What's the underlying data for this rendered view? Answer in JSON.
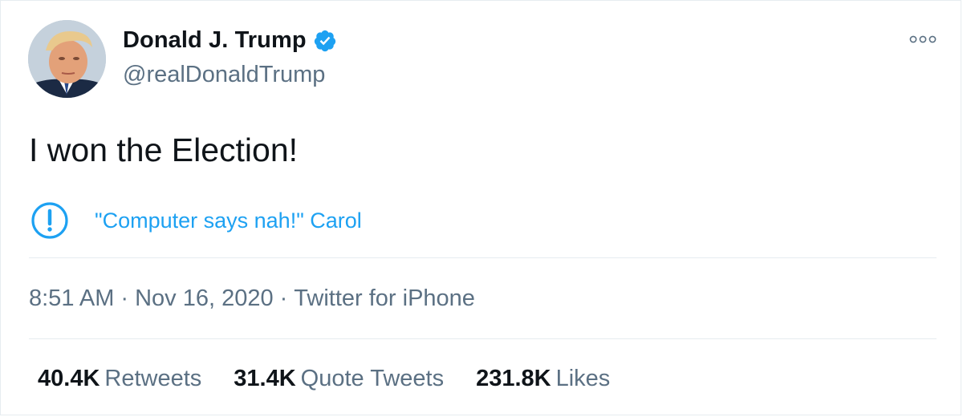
{
  "tweet": {
    "display_name": "Donald J. Trump",
    "handle": "@realDonaldTrump",
    "text": "I won the Election!",
    "notice": "\"Computer says nah!\" Carol",
    "time": "8:51 AM",
    "date": "Nov 16, 2020",
    "source": "Twitter for iPhone",
    "separator": "·"
  },
  "stats": {
    "retweets_count": "40.4K",
    "retweets_label": "Retweets",
    "quotes_count": "31.4K",
    "quotes_label": "Quote Tweets",
    "likes_count": "231.8K",
    "likes_label": "Likes"
  },
  "colors": {
    "text": "#0f1419",
    "muted": "#5b7083",
    "accent": "#1da1f2",
    "divider": "#e6ecf0"
  },
  "icons": {
    "verified": "verified-badge-icon",
    "more": "more-options-icon",
    "notice": "exclamation-circle-icon"
  }
}
